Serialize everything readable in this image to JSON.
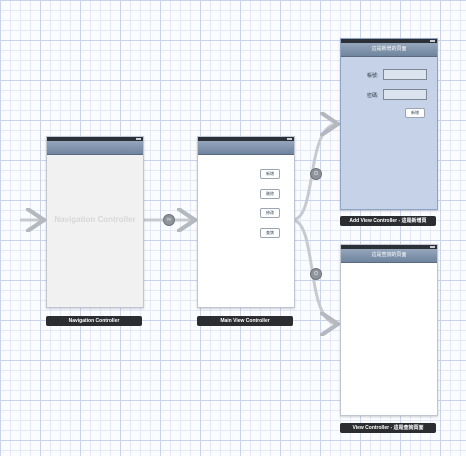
{
  "scenes": {
    "nav": {
      "title_ghost": "Navigation Controller",
      "label": "Navigation Controller"
    },
    "main": {
      "label": "Main View Controller",
      "buttons": [
        "新增",
        "刪除",
        "修改",
        "查詢"
      ]
    },
    "add": {
      "nav_title": "這是新增的頁面",
      "field1_label": "帳號:",
      "field2_label": "密碼:",
      "button": "新增",
      "label": "Add View Controller - 這是新增頁"
    },
    "view": {
      "nav_title": "這是查詢的頁面",
      "label": "View Controller - 這是查詢頁面"
    }
  },
  "segues": {
    "root_badge": "∞",
    "push_badge_1": "⊙",
    "push_badge_2": "⊙"
  },
  "colors": {
    "canvas": "#fbfcff",
    "grid_major": "#c9d4ea",
    "selected_scene": "#c5d2e8",
    "navbar": "#7d90aa"
  }
}
